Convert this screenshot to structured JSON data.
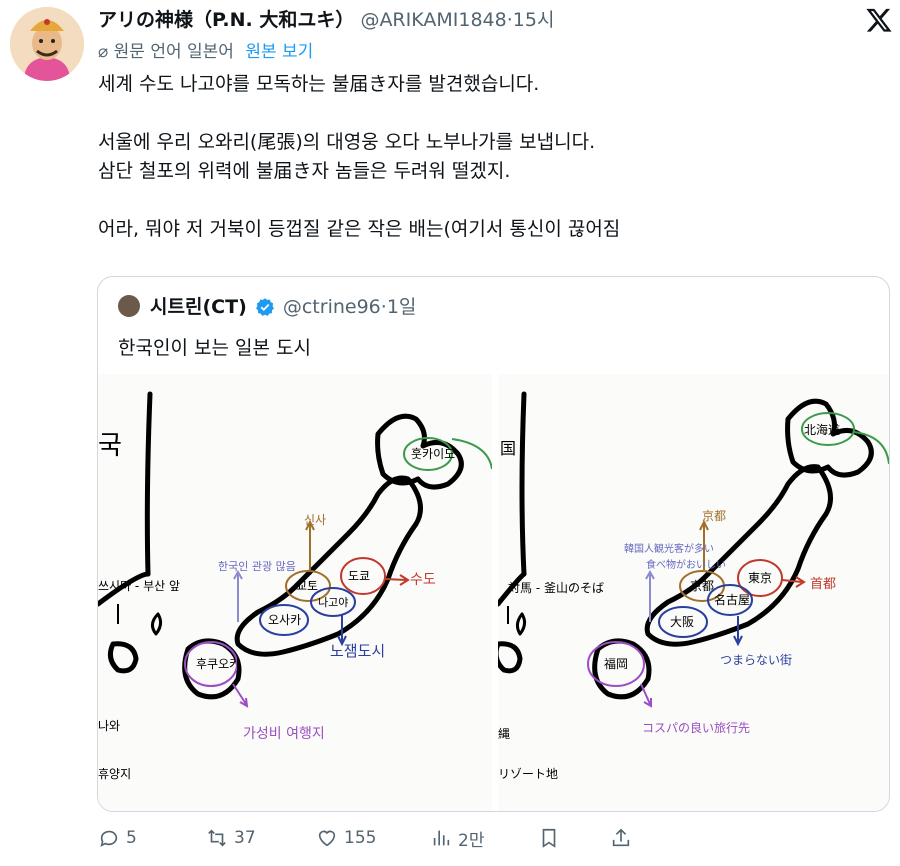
{
  "tweet": {
    "author_name": "アリの神様（P.N. 大和ユキ）",
    "handle": "@ARIKAMI1848",
    "time": "15시",
    "translate_note": "원문 언어 일본어",
    "translate_link": "원본 보기",
    "lines": [
      "세계 수도 나고야를 모독하는 불届き자를 발견했습니다.",
      "서울에 우리 오와리(尾張)의 대영웅 오다 노부나가를 보냅니다.",
      "삼단 철포의 위력에 불届き자 놈들은 두려워 떨겠지.",
      "어라, 뭐야 저 거북이 등껍질 같은 작은 배는(여기서 통신이 끊어짐"
    ]
  },
  "quote": {
    "author_name": "시트린(CT)",
    "handle": "@ctrine96",
    "time": "1일",
    "text": "한국인이 보는 일본 도시"
  },
  "map_left": {
    "korea_label": "국",
    "hokkaido": "훗카이도",
    "tsushima": "쓰시마 - 부산 앞",
    "kyoto": "교토",
    "kyoto_note": "신사",
    "osaka_note": "한국인 관광 많음",
    "tokyo": "도쿄",
    "capital": "수도",
    "nagoya": "나고야",
    "osaka": "오사카",
    "nagoya_note": "노잼도시",
    "fukuoka": "후쿠오카",
    "fukuoka_note": "가성비 여행지",
    "okinawa_a": "나와",
    "okinawa_b": "휴양지"
  },
  "map_right": {
    "korea_label": "国",
    "hokkaido": "北海道",
    "tsushima": "対馬 - 釜山のそば",
    "kyoto": "京都",
    "kyoto_note": "京都",
    "osaka_note_a": "韓国人観光客が多い",
    "osaka_note_b": "食べ物がおいしい",
    "tokyo": "東京",
    "capital": "首都",
    "nagoya": "名古屋",
    "osaka": "大阪",
    "nagoya_note": "つまらない街",
    "fukuoka": "福岡",
    "fukuoka_note": "コスパの良い旅行先",
    "okinawa_a": "縄",
    "okinawa_b": "リゾート地"
  },
  "actions": {
    "replies": "5",
    "reposts": "37",
    "likes": "155",
    "views": "2만"
  },
  "colors": {
    "blue_link": "#1d9bf0",
    "muted": "#536471",
    "red": "#c0392b",
    "green": "#3c9a4a",
    "purple": "#9b4fc2",
    "navy": "#2b3f9e",
    "brown": "#a0702a"
  }
}
